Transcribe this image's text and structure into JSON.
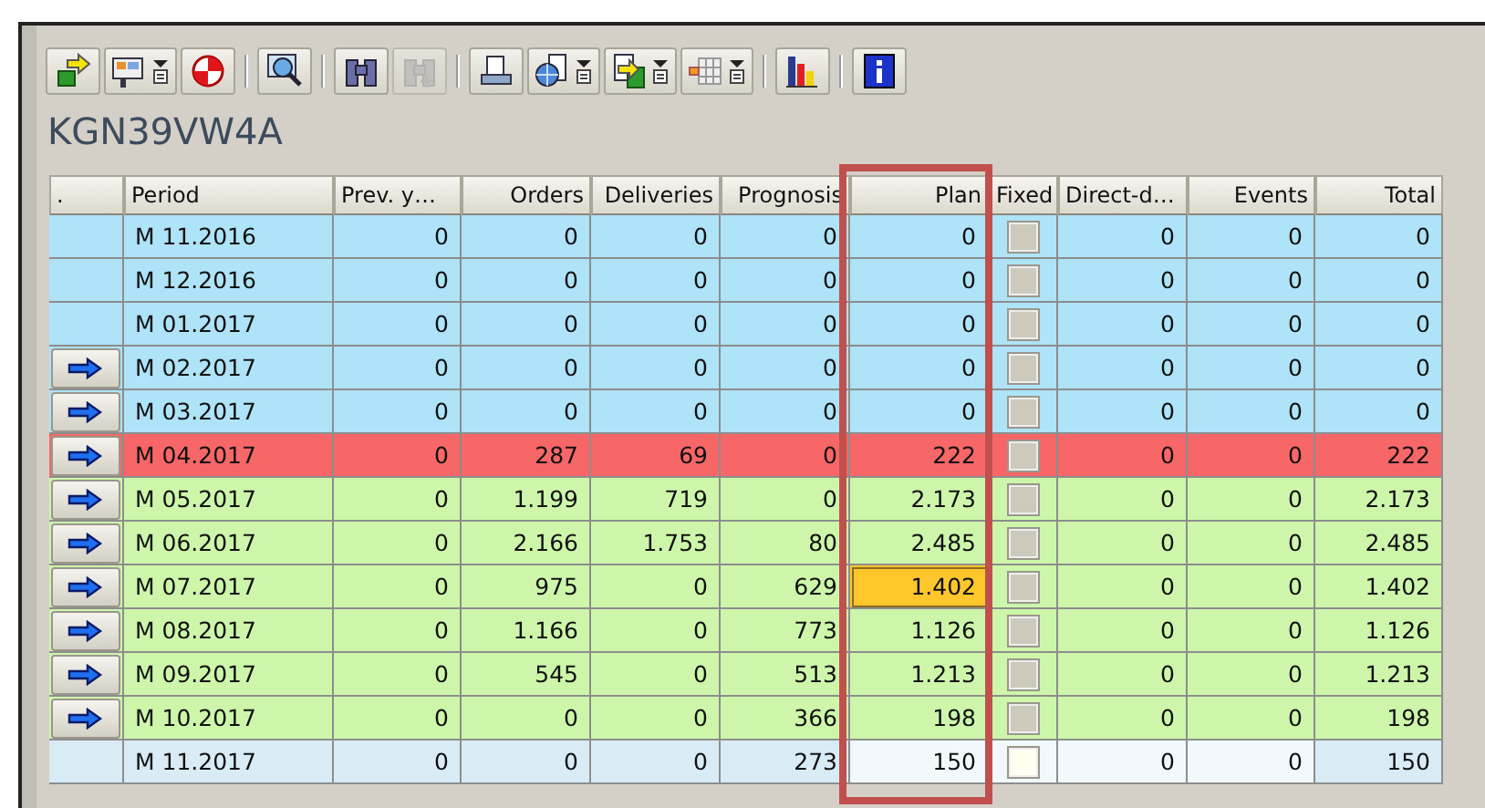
{
  "toolbar": {
    "groups": [
      [
        {
          "dropdown": false,
          "disabled": false
        },
        {
          "dropdown": true,
          "disabled": false
        },
        {
          "dropdown": false,
          "disabled": false
        }
      ],
      [
        {
          "dropdown": false,
          "disabled": false
        }
      ],
      [
        {
          "dropdown": false,
          "disabled": false
        },
        {
          "dropdown": false,
          "disabled": true
        }
      ],
      [
        {
          "dropdown": false,
          "disabled": false
        },
        {
          "dropdown": true,
          "disabled": false
        },
        {
          "dropdown": true,
          "disabled": false
        },
        {
          "dropdown": true,
          "disabled": false
        }
      ],
      [
        {
          "dropdown": false,
          "disabled": false
        }
      ],
      [
        {
          "dropdown": false,
          "disabled": false
        }
      ]
    ]
  },
  "title": "KGN39VW4A",
  "table": {
    "columns": [
      {
        "kind": "mark",
        "label": ".",
        "framed": false
      },
      {
        "kind": "text",
        "label": "Period",
        "framed": false
      },
      {
        "kind": "text",
        "label": "Prev. y…",
        "framed": false
      },
      {
        "kind": "number",
        "label": "Orders",
        "framed": false
      },
      {
        "kind": "number",
        "label": "Deliveries",
        "framed": false
      },
      {
        "kind": "number",
        "label": "Prognosis",
        "framed": false
      },
      {
        "kind": "number",
        "label": "Plan",
        "framed": true
      },
      {
        "kind": "check",
        "label": "Fixed",
        "framed": false
      },
      {
        "kind": "text",
        "label": "Direct-d…",
        "framed": false
      },
      {
        "kind": "number",
        "label": "Events",
        "framed": false
      },
      {
        "kind": "number",
        "label": "Total",
        "framed": false
      }
    ],
    "rows": [
      {
        "color": "#aee3f8",
        "arrow": false,
        "editable": false,
        "fixed_checked": false,
        "plan_selected": false,
        "cells": [
          "",
          "M 11.2016",
          "0",
          "0",
          "0",
          "0",
          "0",
          "",
          "0",
          "0",
          "0"
        ]
      },
      {
        "color": "#aee3f8",
        "arrow": false,
        "editable": false,
        "fixed_checked": false,
        "plan_selected": false,
        "cells": [
          "",
          "M 12.2016",
          "0",
          "0",
          "0",
          "0",
          "0",
          "",
          "0",
          "0",
          "0"
        ]
      },
      {
        "color": "#aee3f8",
        "arrow": false,
        "editable": false,
        "fixed_checked": false,
        "plan_selected": false,
        "cells": [
          "",
          "M 01.2017",
          "0",
          "0",
          "0",
          "0",
          "0",
          "",
          "0",
          "0",
          "0"
        ]
      },
      {
        "color": "#aee3f8",
        "arrow": true,
        "editable": false,
        "fixed_checked": false,
        "plan_selected": false,
        "cells": [
          "",
          "M 02.2017",
          "0",
          "0",
          "0",
          "0",
          "0",
          "",
          "0",
          "0",
          "0"
        ]
      },
      {
        "color": "#aee3f8",
        "arrow": true,
        "editable": false,
        "fixed_checked": false,
        "plan_selected": false,
        "cells": [
          "",
          "M 03.2017",
          "0",
          "0",
          "0",
          "0",
          "0",
          "",
          "0",
          "0",
          "0"
        ]
      },
      {
        "color": "#f76767",
        "arrow": true,
        "editable": false,
        "fixed_checked": false,
        "plan_selected": false,
        "cells": [
          "",
          "M 04.2017",
          "0",
          "287",
          "69",
          "0",
          "222",
          "",
          "0",
          "0",
          "222"
        ]
      },
      {
        "color": "#cdf6aa",
        "arrow": true,
        "editable": false,
        "fixed_checked": false,
        "plan_selected": false,
        "cells": [
          "",
          "M 05.2017",
          "0",
          "1.199",
          "719",
          "0",
          "2.173",
          "",
          "0",
          "0",
          "2.173"
        ]
      },
      {
        "color": "#cdf6aa",
        "arrow": true,
        "editable": false,
        "fixed_checked": false,
        "plan_selected": false,
        "cells": [
          "",
          "M 06.2017",
          "0",
          "2.166",
          "1.753",
          "80",
          "2.485",
          "",
          "0",
          "0",
          "2.485"
        ]
      },
      {
        "color": "#cdf6aa",
        "arrow": true,
        "editable": false,
        "fixed_checked": false,
        "plan_selected": true,
        "cells": [
          "",
          "M 07.2017",
          "0",
          "975",
          "0",
          "629",
          "1.402",
          "",
          "0",
          "0",
          "1.402"
        ]
      },
      {
        "color": "#cdf6aa",
        "arrow": true,
        "editable": false,
        "fixed_checked": false,
        "plan_selected": false,
        "cells": [
          "",
          "M 08.2017",
          "0",
          "1.166",
          "0",
          "773",
          "1.126",
          "",
          "0",
          "0",
          "1.126"
        ]
      },
      {
        "color": "#cdf6aa",
        "arrow": true,
        "editable": false,
        "fixed_checked": false,
        "plan_selected": false,
        "cells": [
          "",
          "M 09.2017",
          "0",
          "545",
          "0",
          "513",
          "1.213",
          "",
          "0",
          "0",
          "1.213"
        ]
      },
      {
        "color": "#cdf6aa",
        "arrow": true,
        "editable": false,
        "fixed_checked": false,
        "plan_selected": false,
        "cells": [
          "",
          "M 10.2017",
          "0",
          "0",
          "0",
          "366",
          "198",
          "",
          "0",
          "0",
          "198"
        ]
      },
      {
        "color": "#d9ecf6",
        "arrow": false,
        "editable": true,
        "fixed_checked": false,
        "plan_selected": false,
        "cells": [
          "",
          "M 11.2017",
          "0",
          "0",
          "0",
          "273",
          "150",
          "",
          "0",
          "0",
          "150"
        ]
      }
    ]
  }
}
